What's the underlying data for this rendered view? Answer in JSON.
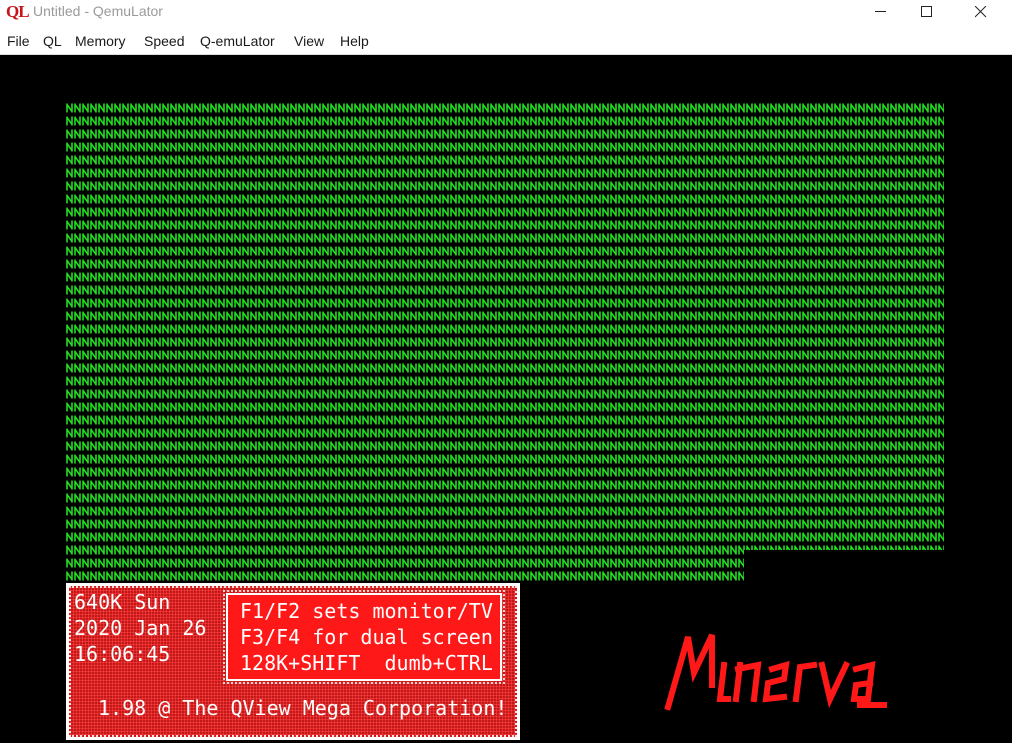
{
  "window": {
    "app_icon_text": "QL",
    "title": "Untitled - QemuLator"
  },
  "menu": {
    "items": [
      "File",
      "QL",
      "Memory",
      "Speed",
      "Q-emuLator",
      "View",
      "Help"
    ]
  },
  "screen": {
    "fill_character": "N",
    "info": {
      "memory": "640K Sun",
      "date": "2020 Jan 26",
      "time": "16:06:45",
      "help_lines": [
        "F1/F2 sets monitor/TV",
        "F3/F4 for dual screen",
        "128K+SHIFT  dumb+CTRL"
      ],
      "copyright": "1.98 @ The QView Mega Corporation!"
    },
    "logo_text": "Minerva"
  },
  "colors": {
    "screen_bg": "#000000",
    "pattern": "#22dd22",
    "panel_red": "#ff1818",
    "logo_red": "#ff1818"
  }
}
